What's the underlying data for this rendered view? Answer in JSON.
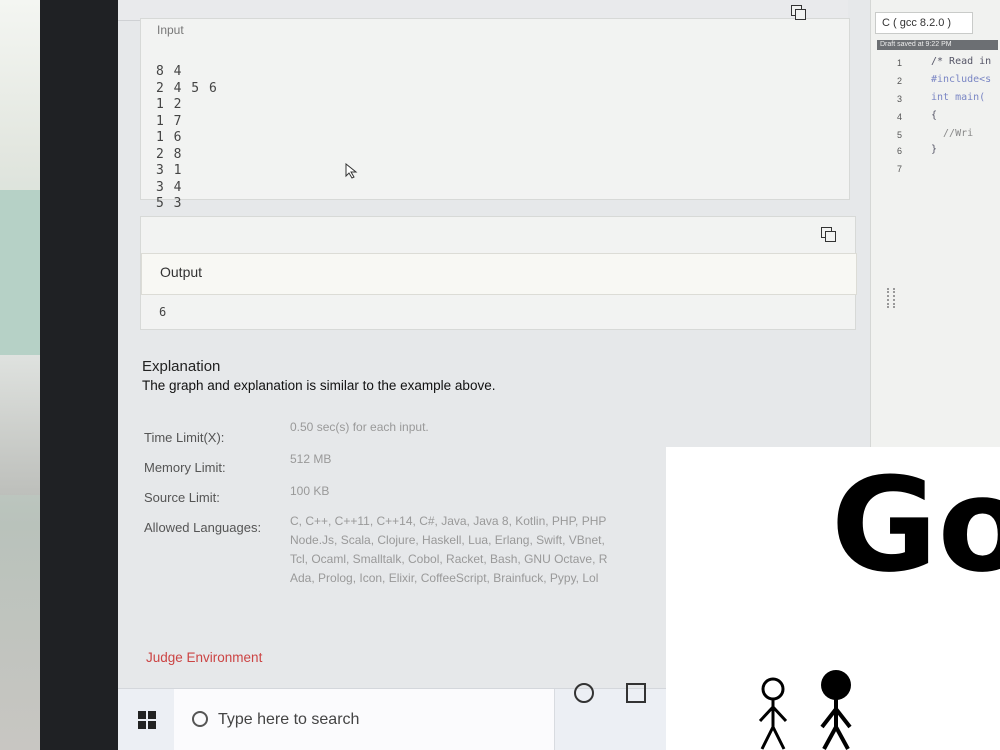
{
  "editor": {
    "language": "C ( gcc 8.2.0 )",
    "draft_status": "Draft saved at 9:22 PM",
    "line_numbers": [
      "1",
      "2",
      "3",
      "4",
      "5",
      "6",
      "7"
    ],
    "code_lines": [
      "/* Read in",
      "#include<s",
      "int main(",
      "{",
      "  //Wri",
      "}",
      ""
    ]
  },
  "sample_input": {
    "label": "Input",
    "lines": [
      "8 4",
      "2 4 5 6",
      "1 2",
      "1 7",
      "1 6",
      "2 8",
      "3 1",
      "3 4",
      "5 3"
    ]
  },
  "sample_output": {
    "label": "Output",
    "value": "6"
  },
  "explanation": {
    "title": "Explanation",
    "text": "The graph and explanation is similar to the example above."
  },
  "limits": {
    "time_label": "Time Limit(X):",
    "time_value": "0.50 sec(s) for each input.",
    "memory_label": "Memory Limit:",
    "memory_value": "512 MB",
    "source_label": "Source Limit:",
    "source_value": "100 KB",
    "languages_label": "Allowed Languages:",
    "languages_lines": [
      "C, C++, C++11, C++14, C#, Java, Java 8, Kotlin, PHP, PHP",
      "Node.Js, Scala, Clojure, Haskell, Lua, Erlang, Swift, VBnet,",
      "Tcl, Ocaml, Smalltalk, Cobol, Racket, Bash, GNU Octave, R",
      "Ada, Prolog, Icon, Elixir, CoffeeScript, Brainfuck, Pypy, Lol"
    ]
  },
  "judge_environment": "Judge Environment",
  "taskbar": {
    "search_placeholder": "Type here to search"
  },
  "overlay": {
    "text": "Go"
  }
}
